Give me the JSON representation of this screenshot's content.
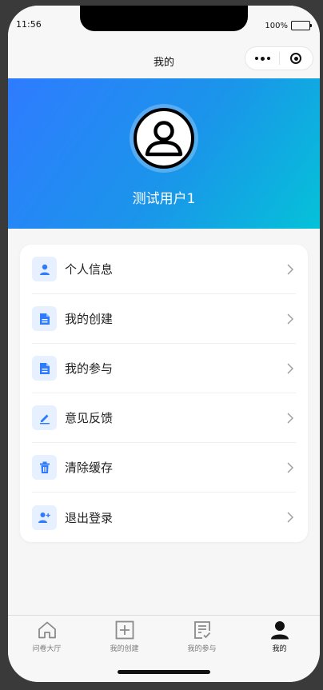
{
  "status": {
    "time": "11:56",
    "battery": "100%"
  },
  "nav": {
    "title": "我的"
  },
  "profile": {
    "username": "测试用户1"
  },
  "menu": {
    "items": [
      {
        "label": "个人信息",
        "icon": "user-icon"
      },
      {
        "label": "我的创建",
        "icon": "document-icon"
      },
      {
        "label": "我的参与",
        "icon": "document-icon"
      },
      {
        "label": "意见反馈",
        "icon": "pencil-icon"
      },
      {
        "label": "清除缓存",
        "icon": "trash-icon"
      },
      {
        "label": "退出登录",
        "icon": "user-add-icon"
      }
    ]
  },
  "tabs": [
    {
      "label": "问卷大厅",
      "icon": "home-icon",
      "active": false
    },
    {
      "label": "我的创建",
      "icon": "plus-square-icon",
      "active": false
    },
    {
      "label": "我的参与",
      "icon": "checklist-icon",
      "active": false
    },
    {
      "label": "我的",
      "icon": "person-icon",
      "active": true
    }
  ],
  "colors": {
    "accent": "#2f7bff",
    "gradient_start": "#2f7bff",
    "gradient_end": "#05c2d8",
    "icon_bg": "#e7f0ff"
  }
}
